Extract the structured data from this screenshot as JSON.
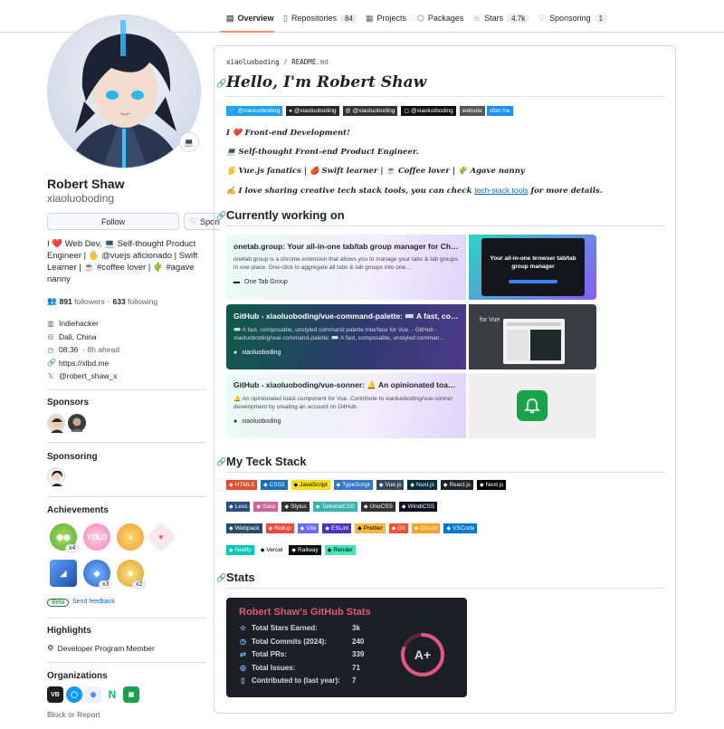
{
  "nav": {
    "tabs": [
      {
        "label": "Overview",
        "icon": "book-icon",
        "count": ""
      },
      {
        "label": "Repositories",
        "icon": "repo-icon",
        "count": "84"
      },
      {
        "label": "Projects",
        "icon": "table-icon",
        "count": ""
      },
      {
        "label": "Packages",
        "icon": "package-icon",
        "count": ""
      },
      {
        "label": "Stars",
        "icon": "star-icon",
        "count": "4.7k"
      },
      {
        "label": "Sponsoring",
        "icon": "heart-icon",
        "count": "1"
      }
    ]
  },
  "profile": {
    "name": "Robert Shaw",
    "login": "xiaoluoboding",
    "status_emoji": "💻",
    "follow_label": "Follow",
    "sponsor_label": "Sponsor",
    "bio_lines": [
      "I ❤️ Web Dev, 💻 Self-thought Product",
      "Engineer | 🖐 @vuejs aficionado | Swift",
      "Learner | ☕ #coffee lover | 🌵 #agave",
      "nanny"
    ],
    "followers_count": "891",
    "followers_label": "followers",
    "dot": "·",
    "following_count": "633",
    "following_label": "following",
    "company": "Indiehacker",
    "location": "Dali, China",
    "time": "08:36",
    "time_note": "- 8h ahead",
    "website": "https://xlbd.me",
    "social": "@robert_shaw_x"
  },
  "sections": {
    "sponsors": "Sponsors",
    "sponsoring": "Sponsoring",
    "achievements": "Achievements",
    "highlights": "Highlights",
    "organizations": "Organizations"
  },
  "achievements": {
    "counts": [
      "x4",
      "x3",
      "x2"
    ],
    "beta": "Beta",
    "feedback": "Send feedback"
  },
  "highlight": "Developer Program Member",
  "block_report": "Block or Report",
  "readme": {
    "crumb_user": "xiaoluoboding",
    "crumb_sep": "/",
    "crumb_file": "README",
    "crumb_ext": ".md",
    "title": "Hello, I'm Robert Shaw",
    "social_badges": [
      {
        "label": "@xiaoluoboding",
        "color": "#1da1f2"
      },
      {
        "label": "@xiaoluoboding",
        "color": "#24292e"
      },
      {
        "label": "@xiaoluoboding",
        "color": "#333333"
      },
      {
        "label": "@xiaoluoboding",
        "color": "#111111"
      }
    ],
    "website_badge_left": "website",
    "website_badge_right": "xlbd.me",
    "intro_1": "I ❤️ Front-end Development!",
    "intro_2": "💻 Self-thought Front-end Product Engineer.",
    "intro_3": "🖐 Vue.js fanatics | 🍎 Swift learner | ☕ Coffee lover | 🌵 Agave nanny",
    "intro_4_pre": "✍️ I love sharing creative tech stack tools, you can check ",
    "intro_4_link": "tech-stack tools",
    "intro_4_post": " for more details.",
    "h2_working": "Currently working on",
    "cards": [
      {
        "title": "onetab.group: Your all-in-one tab/tab group manager for Chro...",
        "desc": "onetab.group is a chrome extension that allows you to manage your tabs & tab groups in one place. One-click to aggregate all tabs & tab groups into one...",
        "site": "One Tab Group",
        "img_text_1": "Your all-in-one browser tab/tab",
        "img_text_2": "group manager"
      },
      {
        "title": "GitHub - xiaoluoboding/vue-command-palette: ⌨️ A fast, comp...",
        "desc": "⌨️ A fast, composable, unstyled command palette interface for Vue. - GitHub - xiaoluoboding/vue-command-palette: ⌨️ A fast, composable, unstyled comman...",
        "site": "xiaoluoboding",
        "img_text_1": "for Vue",
        "img_text_2": ""
      },
      {
        "title": "GitHub - xiaoluoboding/vue-sonner: 🔔 An opinionated toast c...",
        "desc": "🔔 An opinionated toast component for Vue. Contribute to xiaoluoboding/vue-sonner development by creating an account on GitHub.",
        "site": "xiaoluoboding",
        "img_text_1": "",
        "img_text_2": ""
      }
    ],
    "h2_stack": "My Teck Stack",
    "stack_rows": [
      [
        {
          "label": "HTML5",
          "color": "#e34f26",
          "fg": "#ffffff"
        },
        {
          "label": "CSS3",
          "color": "#1572b6",
          "fg": "#ffffff"
        },
        {
          "label": "JavaScript",
          "color": "#f7df1e",
          "fg": "#000000"
        },
        {
          "label": "TypeScript",
          "color": "#3178c6",
          "fg": "#ffffff"
        },
        {
          "label": "Vue.js",
          "color": "#35495e",
          "fg": "#ffffff"
        },
        {
          "label": "Nuxt.js",
          "color": "#002e3b",
          "fg": "#ffffff"
        },
        {
          "label": "React.js",
          "color": "#20232a",
          "fg": "#ffffff"
        },
        {
          "label": "Next.js",
          "color": "#000000",
          "fg": "#ffffff"
        }
      ],
      [
        {
          "label": "Less",
          "color": "#2b4c80",
          "fg": "#ffffff"
        },
        {
          "label": "Sass",
          "color": "#cc6699",
          "fg": "#ffffff"
        },
        {
          "label": "Stylus",
          "color": "#333333",
          "fg": "#ffffff"
        },
        {
          "label": "TailwindCSS",
          "color": "#38b2ac",
          "fg": "#ffffff"
        },
        {
          "label": "UnoCSS",
          "color": "#333333",
          "fg": "#ffffff"
        },
        {
          "label": "WindiCSS",
          "color": "#0b1120",
          "fg": "#ffffff"
        }
      ],
      [
        {
          "label": "Webpack",
          "color": "#2a4a6a",
          "fg": "#ffffff"
        },
        {
          "label": "Rollup",
          "color": "#ec4a3f",
          "fg": "#ffffff"
        },
        {
          "label": "Vite",
          "color": "#646cff",
          "fg": "#ffffff"
        },
        {
          "label": "ESLint",
          "color": "#4b32c3",
          "fg": "#ffffff"
        },
        {
          "label": "Prettier",
          "color": "#f7b93e",
          "fg": "#000000"
        },
        {
          "label": "Git",
          "color": "#f05033",
          "fg": "#ffffff"
        },
        {
          "label": "GitLab",
          "color": "#fca121",
          "fg": "#ffffff"
        },
        {
          "label": "VSCode",
          "color": "#0078d7",
          "fg": "#ffffff"
        }
      ],
      [
        {
          "label": "Netlify",
          "color": "#00c7b7",
          "fg": "#ffffff"
        },
        {
          "label": "Vercel",
          "color": "#ffffff",
          "fg": "#000000"
        },
        {
          "label": "Railway",
          "color": "#0b0d0e",
          "fg": "#ffffff"
        },
        {
          "label": "Render",
          "color": "#46e3b7",
          "fg": "#000000"
        }
      ]
    ],
    "h2_stats": "Stats"
  },
  "stats": {
    "title": "Robert Shaw's GitHub Stats",
    "rows": [
      {
        "label": "Total Stars Earned:",
        "value": "3k",
        "icon": "star-icon"
      },
      {
        "label": "Total Commits (2024):",
        "value": "240",
        "icon": "history-icon"
      },
      {
        "label": "Total PRs:",
        "value": "339",
        "icon": "pr-icon"
      },
      {
        "label": "Total Issues:",
        "value": "71",
        "icon": "issue-icon"
      },
      {
        "label": "Contributed to (last year):",
        "value": "7",
        "icon": "repo-icon"
      }
    ],
    "grade": "A+",
    "grade_progress": 0.8,
    "accent": "#e0587a"
  }
}
